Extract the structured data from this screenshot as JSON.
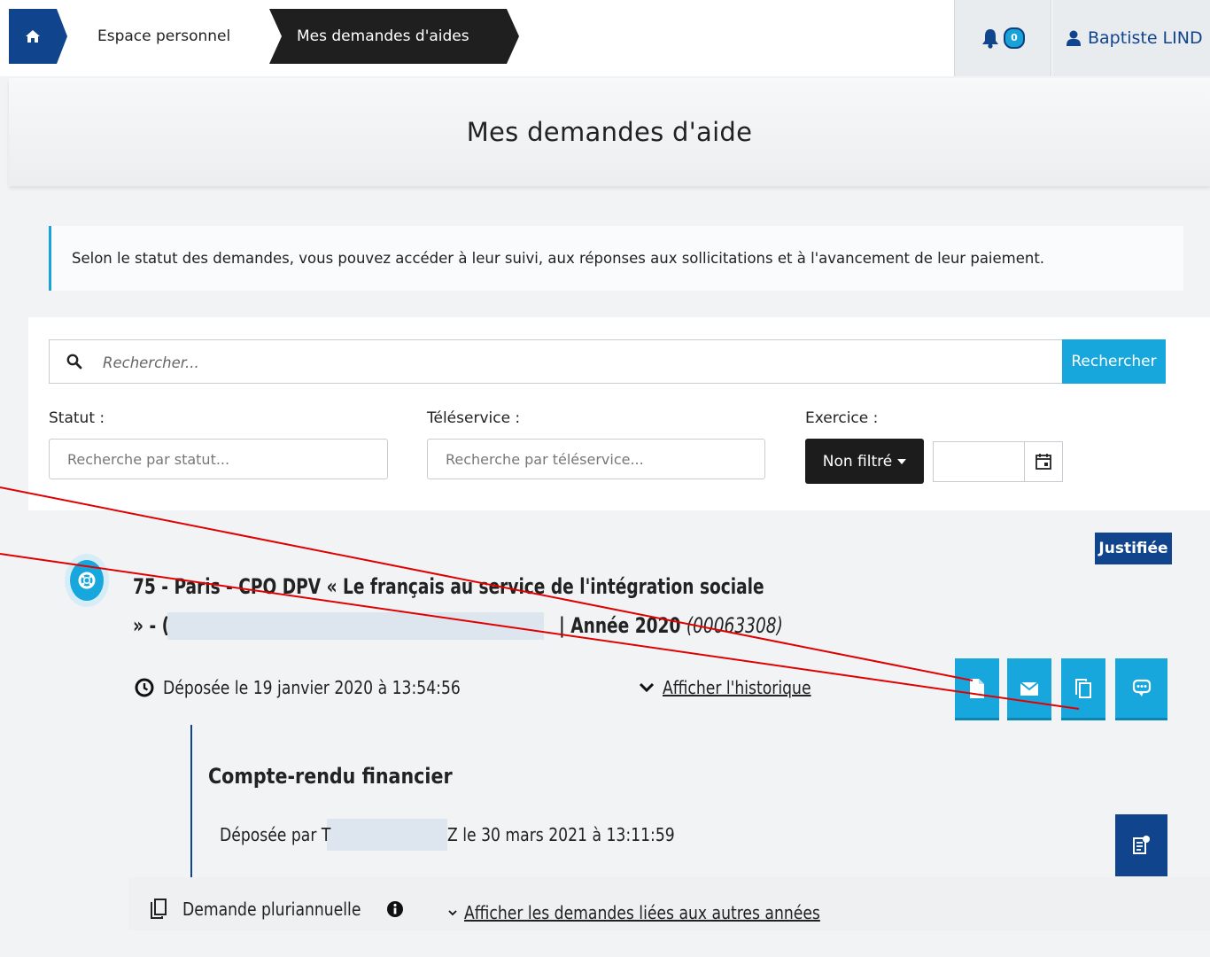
{
  "breadcrumb": {
    "home_icon": "home-icon",
    "items": [
      "Espace personnel",
      "Mes demandes d'aides"
    ]
  },
  "header": {
    "notification_count": "0",
    "user_name": "Baptiste LIND"
  },
  "page": {
    "title": "Mes demandes d'aide",
    "info": "Selon le statut des demandes, vous pouvez accéder à leur suivi, aux réponses aux sollicitations et à l'avancement de leur paiement."
  },
  "search": {
    "placeholder": "Rechercher...",
    "button": "Rechercher",
    "statut_label": "Statut :",
    "statut_placeholder": "Recherche par statut...",
    "teleservice_label": "Téléservice :",
    "teleservice_placeholder": "Recherche par téléservice...",
    "exercice_label": "Exercice :",
    "exercice_filter": "Non filtré"
  },
  "request": {
    "status": "Justifiée",
    "title_line1": "75 - Paris - CPO DPV « Le français au service de l'intégration sociale",
    "title_line2_start": "» - (",
    "title_line2_end": "| Année 2020",
    "number": "(00063308)",
    "deposit": "Déposée le 19 janvier 2020 à 13:54:56",
    "history_link": "Afficher l'historique",
    "actions": [
      "document-icon",
      "envelope-icon",
      "copy-icon",
      "comment-icon"
    ]
  },
  "compte_rendu": {
    "title": "Compte-rendu financier",
    "deposit_pre": "Déposée par T",
    "deposit_post": "Z le 30 mars 2021 à 13:11:59"
  },
  "pluriannuelle": {
    "label": "Demande pluriannuelle",
    "link": "Afficher les demandes liées aux autres années"
  },
  "colors": {
    "brand_blue": "#10448c",
    "accent_cyan": "#17a7dc",
    "dark": "#1c1c1c",
    "annotation_red": "#e00000"
  }
}
